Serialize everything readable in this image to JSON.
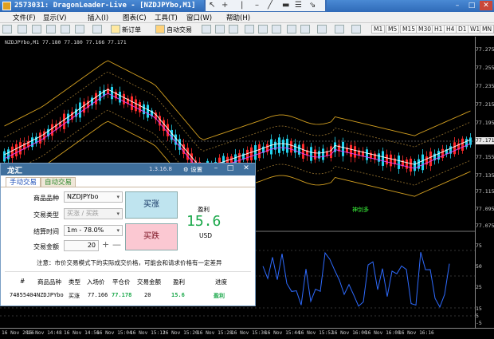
{
  "window": {
    "title": "2573031: DragonLeader-Live - [NZDJPYbo,M1]"
  },
  "menu": [
    "文件(F)",
    "显示(V)",
    "插入(I)",
    "图表(C)",
    "工具(T)",
    "窗口(W)",
    "帮助(H)"
  ],
  "toolbar": {
    "new_order": "新订单",
    "auto_trade": "自动交易",
    "timeframes": [
      "M1",
      "M5",
      "M15",
      "M30",
      "H1",
      "H4",
      "D1",
      "W1",
      "MN"
    ]
  },
  "chart": {
    "symbol_info": "NZDJPYbo,M1  77.180 77.180 77.166 77.171",
    "price_labels": [
      "77.275",
      "77.255",
      "77.235",
      "77.215",
      "77.195",
      "77.175",
      "77.155",
      "77.135",
      "77.115",
      "77.095",
      "77.075",
      "75",
      "50",
      "25",
      "15",
      "5",
      "-5"
    ],
    "current_price": "77.171",
    "time_labels": [
      "16 Nov 2016",
      "16 Nov 14:48",
      "16 Nov 14:56",
      "16 Nov 15:04",
      "16 Nov 15:12",
      "16 Nov 15:20",
      "16 Nov 15:28",
      "16 Nov 15:36",
      "16 Nov 15:44",
      "16 Nov 15:52",
      "16 Nov 16:00",
      "16 Nov 16:08",
      "16 Nov 16:16"
    ],
    "indicator_label": "神剑多"
  },
  "panel": {
    "title": "龙汇",
    "version": "1.3.16.8",
    "settings_label": "设置",
    "tabs": [
      "手动交易",
      "自动交易"
    ],
    "fields": {
      "symbol_label": "商品品种",
      "symbol_value": "NZDJPYbo",
      "type_label": "交易类型",
      "type_value": "买涨 / 买跌",
      "expiry_label": "结算时间",
      "expiry_value": "1m - 78.0%",
      "amount_label": "交易金额",
      "amount_value": "20"
    },
    "buy_label": "买涨",
    "sell_label": "买跌",
    "profit_label": "盈利",
    "profit_value": "15.6",
    "currency": "USD",
    "notice": "注意：市价交易模式下的实际成交价格，可能会和请求价格有一定差异",
    "table": {
      "headers": [
        "#",
        "商品品种",
        "类型",
        "入场价",
        "平仓价",
        "交易金额",
        "盈利",
        "进度"
      ],
      "rows": [
        [
          "74855404",
          "NZDJPYbo",
          "买涨",
          "77.166",
          "77.178",
          "20",
          "15.6",
          "盈利"
        ]
      ]
    }
  }
}
